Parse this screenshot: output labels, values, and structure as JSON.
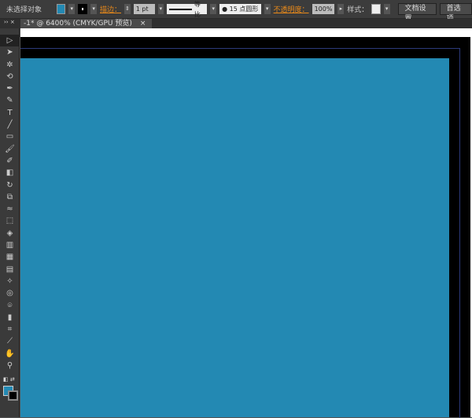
{
  "control": {
    "selection": "未选择对象",
    "stroke_label": "描边：",
    "stroke_weight": "1 pt",
    "profile": "等比",
    "brush": "15 点圆形",
    "opacity_label": "不透明度：",
    "opacity": "100%",
    "style_label": "样式：",
    "doc_setup": "文档设置",
    "prefs": "首选项"
  },
  "colors": {
    "fill": "#2389b3"
  },
  "tab": {
    "title": "-1* @ 6400% (CMYK/GPU 预览)",
    "close": "×"
  },
  "tools": [
    "▷",
    "➤",
    "✲",
    "⟲",
    "✒",
    "✎",
    "T",
    "╱",
    "▭",
    "🖌",
    "✐",
    "◧",
    "↻",
    "⧉",
    "≈",
    "⬚",
    "◈",
    "▥",
    "▦",
    "▤",
    "✧",
    "◎",
    "⌾",
    "▮",
    "⌗",
    "⟋",
    "✋",
    "⚲"
  ]
}
